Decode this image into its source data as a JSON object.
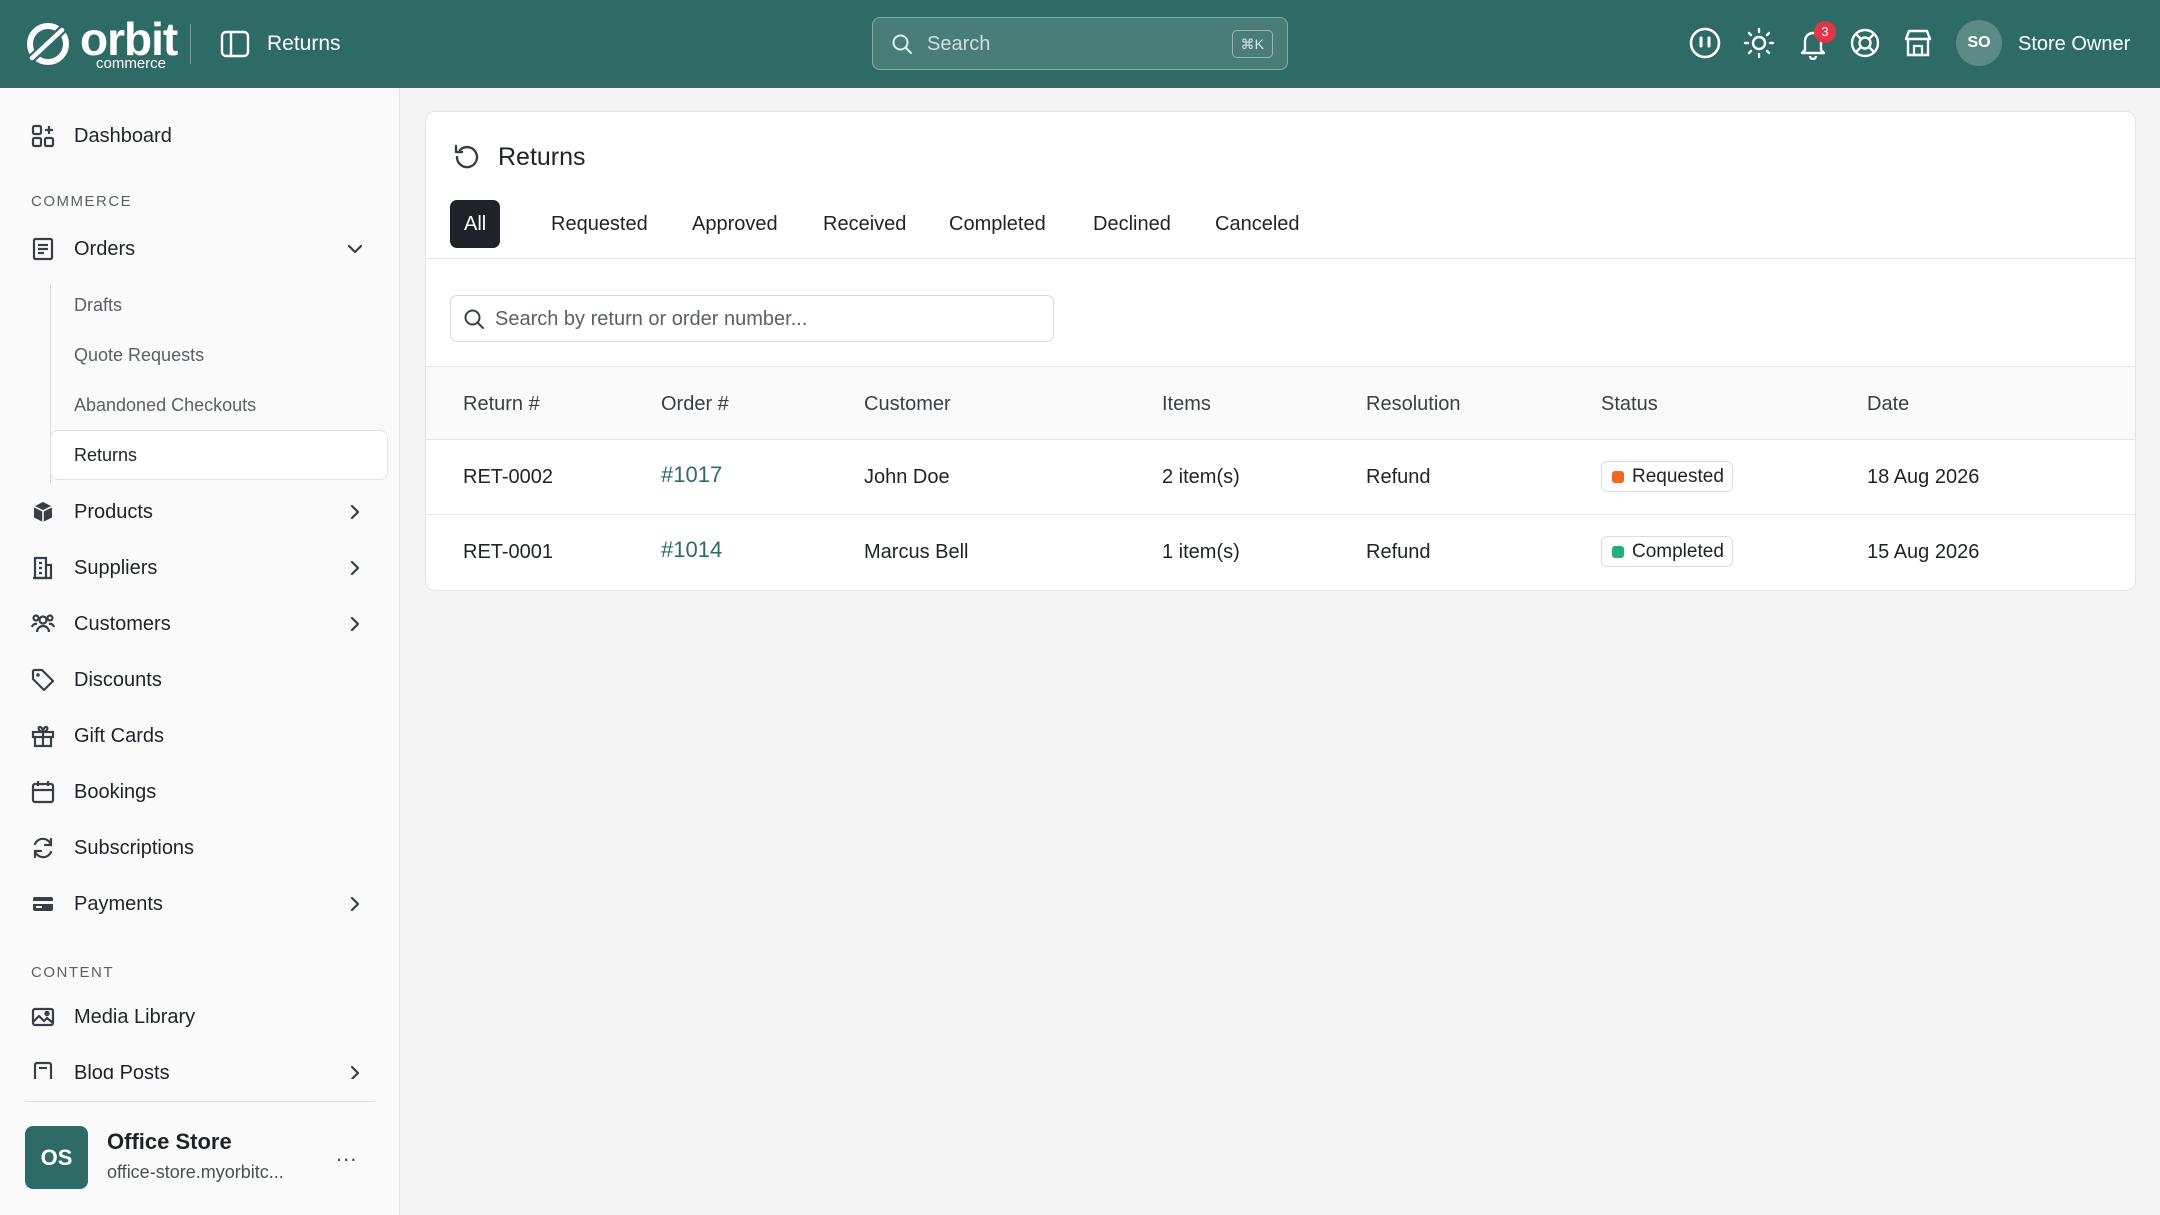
{
  "header": {
    "logo_word": "orbit",
    "logo_sub": "commerce",
    "page_title": "Returns",
    "search_placeholder": "Search",
    "search_shortcut": "⌘K",
    "notifications_count": "3",
    "user_initials": "SO",
    "user_name": "Store Owner"
  },
  "sidebar": {
    "dashboard": "Dashboard",
    "section_commerce": "COMMERCE",
    "orders": "Orders",
    "orders_sub": [
      "Drafts",
      "Quote Requests",
      "Abandoned Checkouts",
      "Returns"
    ],
    "products": "Products",
    "suppliers": "Suppliers",
    "customers": "Customers",
    "discounts": "Discounts",
    "gift_cards": "Gift Cards",
    "bookings": "Bookings",
    "subscriptions": "Subscriptions",
    "payments": "Payments",
    "section_content": "CONTENT",
    "media_library": "Media Library",
    "blog_posts": "Blog Posts",
    "store": {
      "initials": "OS",
      "name": "Office Store",
      "url": "office-store.myorbitc...",
      "more": "..."
    }
  },
  "main": {
    "title": "Returns",
    "tabs": [
      "All",
      "Requested",
      "Approved",
      "Received",
      "Completed",
      "Declined",
      "Canceled"
    ],
    "active_tab": "All",
    "search_placeholder": "Search by return or order number...",
    "columns": [
      "Return #",
      "Order #",
      "Customer",
      "Items",
      "Resolution",
      "Status",
      "Date"
    ],
    "rows": [
      {
        "return_no": "RET-0002",
        "order_no": "#1017",
        "customer": "John Doe",
        "items": "2 item(s)",
        "resolution": "Refund",
        "status": "Requested",
        "status_color": "#f06a1d",
        "date": "18 Aug 2026"
      },
      {
        "return_no": "RET-0001",
        "order_no": "#1014",
        "customer": "Marcus Bell",
        "items": "1 item(s)",
        "resolution": "Refund",
        "status": "Completed",
        "status_color": "#22b07d",
        "date": "15 Aug 2026"
      }
    ]
  },
  "colors": {
    "brand": "#2f6b66",
    "requested": "#f06a1d",
    "completed": "#22b07d",
    "notification": "#e0364a"
  }
}
